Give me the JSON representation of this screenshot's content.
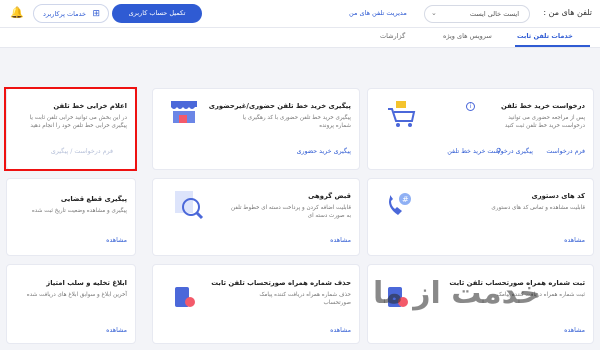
{
  "header": {
    "title": "تلفن های من :",
    "selected_number": "ایست خالی ایست",
    "manage_numbers": "مدیریت تلفن های من",
    "complete_account": "تکمیل حساب کاربری",
    "popular_services": "خدمات پرکاربرد"
  },
  "tabs": [
    {
      "label": "خدمات تلفن ثابت",
      "active": true
    },
    {
      "label": "سرویس های ویژه",
      "active": false
    },
    {
      "label": "گزارشات",
      "active": false
    }
  ],
  "cards": [
    {
      "title": "درخواست خرید خط تلفن",
      "desc": "پس از مراجعه حضوری می توانید درخواست خرید خط تلفن ثبت کنید",
      "links": [
        "فرم درخواست",
        "پیگیری درخواست خرید خط تلفن"
      ],
      "icon": "cart-icon"
    },
    {
      "title": "پیگیری خرید خط تلفن حضوری/غیرحضوری",
      "desc": "پیگیری خرید خط تلفن حضوری با کد رهگیری یا شماره پرونده",
      "links": [
        "پیگیری خرید حضوری"
      ],
      "icon": "shop-icon"
    },
    {
      "title": "اعلام خرابی خط تلفن",
      "desc": "در این بخش می توانید خرابی تلفن ثابت یا پیگیری خرابی خط تلفن خود را انجام دهید",
      "links": [
        "فرم درخواست / پیگیری"
      ],
      "icon": ""
    },
    {
      "title": "کد های دستوری",
      "desc": "قابلیت مشاهده و تماس کد های دستوری",
      "links": [
        "مشاهده"
      ],
      "icon": "phone-icon"
    },
    {
      "title": "قبض گروهی",
      "desc": "قابلیت اضافه کردن و پرداخت دسته ای خطوط تلفن به صورت دسته ای",
      "links": [
        "مشاهده"
      ],
      "icon": "search-bill-icon"
    },
    {
      "title": "پیگیری قطع قضایی",
      "desc": "پیگیری و مشاهده وضعیت تاریخ ثبت شده",
      "links": [
        "مشاهده"
      ],
      "icon": ""
    },
    {
      "title": "ثبت شماره همراه صورتحساب تلفن ثابت",
      "desc": "ثبت شماره همراه دریافت کننده پیامک",
      "links": [
        "مشاهده"
      ],
      "icon": "phone-bill-icon"
    },
    {
      "title": "حذف شماره همراه صورتحساب تلفن ثابت",
      "desc": "حذف شماره همراه دریافت کننده پیامک صورتحساب",
      "links": [
        "مشاهده"
      ],
      "icon": "phone-bill-icon"
    },
    {
      "title": "ابلاغ تخلیه و سلب امتیاز",
      "desc": "آخرین ابلاغ و سوابق ابلاغ های دریافت شده",
      "links": [
        "مشاهده"
      ],
      "icon": ""
    }
  ],
  "watermark": "خدمت از ما"
}
